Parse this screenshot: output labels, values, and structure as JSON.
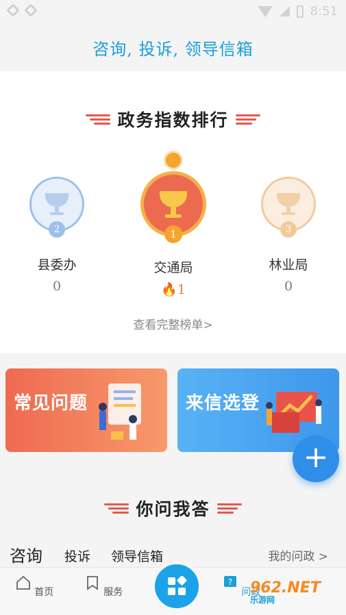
{
  "status_bar": {
    "time": "8:51"
  },
  "header": {
    "title": "咨询, 投诉, 领导信箱"
  },
  "ranking": {
    "section_title": "政务指数排行",
    "entries": [
      {
        "rank": "2",
        "dept": "县委办",
        "score": "0"
      },
      {
        "rank": "1",
        "dept": "交通局",
        "score": "1"
      },
      {
        "rank": "3",
        "dept": "林业局",
        "score": "0"
      }
    ],
    "view_full": "查看完整榜单>"
  },
  "banners": {
    "faq": "常见问题",
    "letters": "来信选登"
  },
  "fab": {
    "label": "+"
  },
  "qa": {
    "section_title": "你问我答",
    "tabs": [
      "咨询",
      "投诉",
      "领导信箱"
    ],
    "my_gov": "我的问政 >"
  },
  "bottom_nav": {
    "home": "首页",
    "service": "服务",
    "ask": "问政"
  },
  "watermark": {
    "brand": "962.NET",
    "sub": "乐游网"
  },
  "colors": {
    "accent": "#1a9fd8",
    "red": "#e7574b",
    "gold": "#f4a52c",
    "blue_banner": "#4aa8f0",
    "orange_banner": "#ef6a52"
  }
}
